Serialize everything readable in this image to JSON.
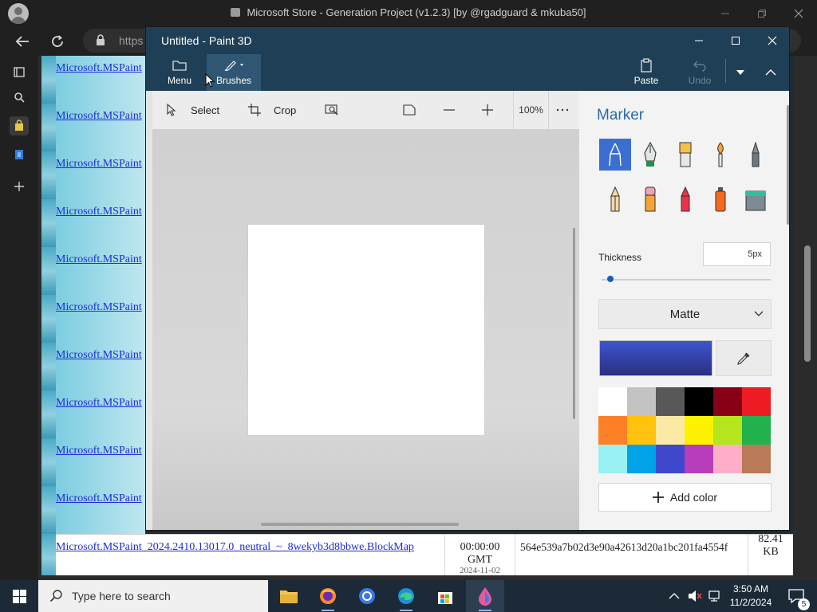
{
  "browser": {
    "title": "Microsoft Store - Generation Project (v1.2.3) [by @rgadguard & mkuba50]",
    "address": "https",
    "file_links": [
      "Microsoft.MSPaint",
      "Microsoft.MSPaint",
      "Microsoft.MSPaint",
      "Microsoft.MSPaint",
      "Microsoft.MSPaint",
      "Microsoft.MSPaint",
      "Microsoft.MSPaint",
      "Microsoft.MSPaint",
      "Microsoft.MSPaint",
      "Microsoft.MSPaint"
    ],
    "row": {
      "filename": "Microsoft.MSPaint_2024.2410.13017.0_neutral_~_8wekyb3d8bbwe.BlockMap",
      "time": "00:00:00",
      "timezone": "GMT",
      "next_date": "2024-11-02",
      "sha1": "564e539a7b02d3e90a42613d20a1bc201fa4554f",
      "size_value": "82.41",
      "size_unit": "KB"
    }
  },
  "paint": {
    "title": "Untitled - Paint 3D",
    "ribbon": {
      "menu": "Menu",
      "brushes": "Brushes",
      "paste": "Paste",
      "undo": "Undo"
    },
    "commands": {
      "select": "Select",
      "crop": "Crop",
      "zoom": "100%"
    },
    "panel": {
      "title": "Marker",
      "thickness_label": "Thickness",
      "thickness_value": "5px",
      "thickness_fraction": 0.05,
      "finish": "Matte",
      "add_color": "Add color",
      "current_color": "#3e55cf",
      "palette": [
        "#ffffff",
        "#c3c3c3",
        "#585858",
        "#000000",
        "#880015",
        "#ed1c24",
        "#ff7f27",
        "#ffc20e",
        "#fde9a6",
        "#fff200",
        "#b5e61d",
        "#22b14c",
        "#99f1f4",
        "#00a2e8",
        "#3f48cc",
        "#b83dba",
        "#ffaec9",
        "#b97a57"
      ]
    }
  },
  "taskbar": {
    "search_placeholder": "Type here to search",
    "time": "3:50 AM",
    "date": "11/2/2024",
    "notification_count": "5"
  }
}
